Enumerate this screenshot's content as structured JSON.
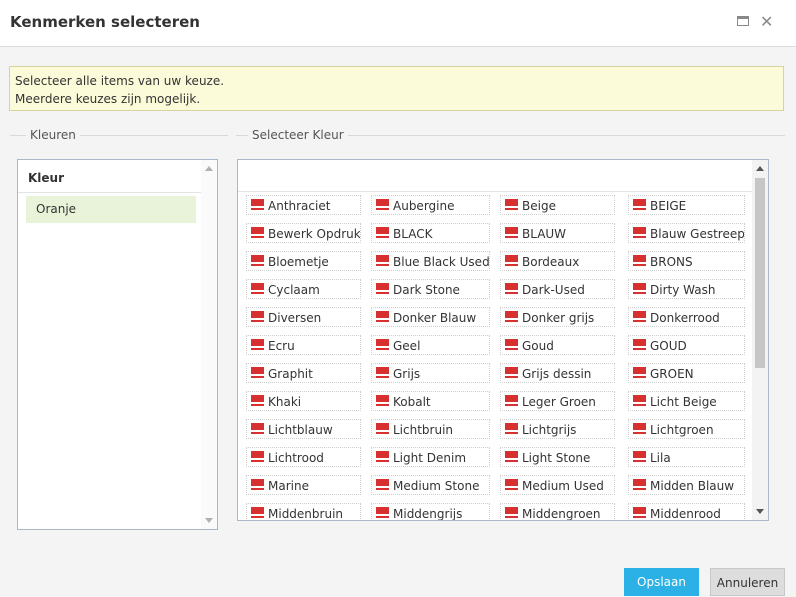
{
  "window": {
    "title": "Kenmerken selecteren",
    "maximize_icon": "maximize-icon",
    "close_icon": "close-icon",
    "close_glyph": "✕"
  },
  "notice": {
    "line1": "Selecteer alle items van uw keuze.",
    "line2": "Meerdere keuzes zijn mogelijk."
  },
  "left_section": {
    "legend": "Kleuren",
    "header": "Kleur",
    "selected_item": "Oranje"
  },
  "right_section": {
    "legend": "Selecteer Kleur",
    "colors": [
      "Anthraciet",
      "Aubergine",
      "Beige",
      "BEIGE",
      "Bewerk Opdruk",
      "BLACK",
      "BLAUW",
      "Blauw Gestreept",
      "Bloemetje",
      "Blue Black Used",
      "Bordeaux",
      "BRONS",
      "Cyclaam",
      "Dark Stone",
      "Dark-Used",
      "Dirty Wash",
      "Diversen",
      "Donker Blauw",
      "Donker grijs",
      "Donkerrood",
      "Ecru",
      "Geel",
      "Goud",
      "GOUD",
      "Graphit",
      "Grijs",
      "Grijs dessin",
      "GROEN",
      "Khaki",
      "Kobalt",
      "Leger Groen",
      "Licht Beige",
      "Lichtblauw",
      "Lichtbruin",
      "Lichtgrijs",
      "Lichtgroen",
      "Lichtrood",
      "Light Denim",
      "Light Stone",
      "Lila",
      "Marine",
      "Medium Stone",
      "Medium Used",
      "Midden Blauw",
      "Middenbruin",
      "Middengrijs",
      "Middengroen",
      "Middenrood"
    ]
  },
  "buttons": {
    "save": "Opslaan",
    "cancel": "Annuleren"
  },
  "colors": {
    "accent": "#2cb1e6",
    "flag": "#d63030",
    "notice_bg": "#fbfbd9",
    "selected_bg": "#e9f3d9"
  }
}
